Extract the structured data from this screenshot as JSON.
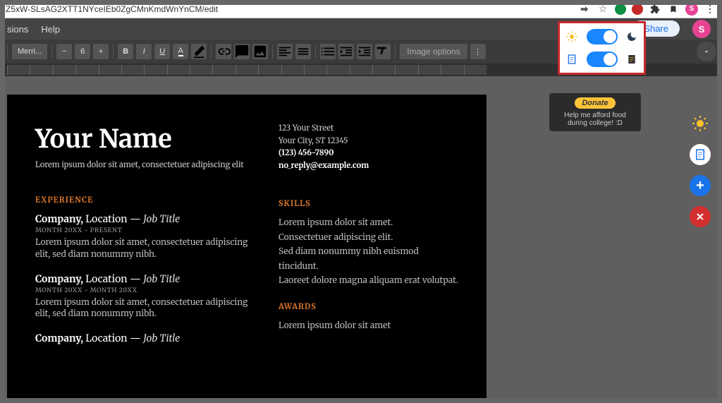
{
  "url": "Z5xW-SLsAG2XTT1NYceIEb0ZgCMnKmdWnYnCM/edit",
  "avatar_letter": "S",
  "menubar": {
    "items": [
      "sions",
      "Help"
    ],
    "share": "Share"
  },
  "toolbar": {
    "font_family": "Merri...",
    "font_size": "6",
    "image_options": "Image options"
  },
  "extension": {
    "donate_label": "Donate",
    "donate_text": "Help me afford food during college! :D"
  },
  "doc": {
    "name": "Your Name",
    "tagline": "Lorem ipsum dolor sit amet, consectetuer adipiscing elit",
    "contact": {
      "street": "123 Your Street",
      "city": "Your City, ST 12345",
      "phone": "(123) 456-7890",
      "email": "no_reply@example.com"
    },
    "sections": {
      "experience_head": "EXPERIENCE",
      "skills_head": "SKILLS",
      "awards_head": "AWARDS"
    },
    "jobs": [
      {
        "company": "Company,",
        "location": "Location",
        "sep": "—",
        "title": "Job Title",
        "date": "MONTH 20XX - PRESENT",
        "body": "Lorem ipsum dolor sit amet, consectetuer adipiscing elit, sed diam nonummy nibh."
      },
      {
        "company": "Company,",
        "location": "Location",
        "sep": "—",
        "title": "Job Title",
        "date": "MONTH 20XX - MONTH 20XX",
        "body": "Lorem ipsum dolor sit amet, consectetuer adipiscing elit, sed diam nonummy nibh."
      },
      {
        "company": "Company,",
        "location": "Location",
        "sep": "—",
        "title": "Job Title"
      }
    ],
    "skills_body": "Lorem ipsum dolor sit amet.\nConsectetuer adipiscing elit.\nSed diam nonummy nibh euismod tincidunt.\nLaoreet dolore magna aliquam erat volutpat.",
    "awards_body": "Lorem ipsum dolor sit amet"
  }
}
